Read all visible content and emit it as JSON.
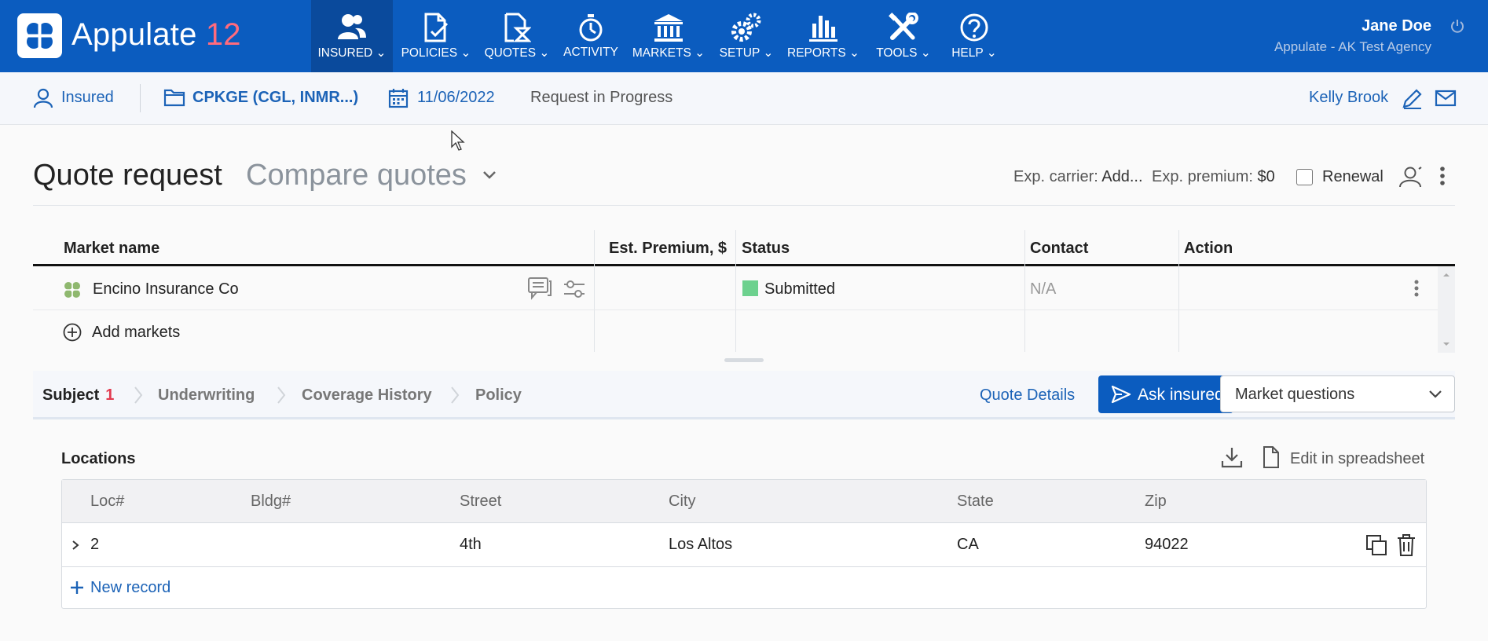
{
  "brand": {
    "name": "Appulate",
    "version": "12"
  },
  "nav": [
    {
      "label": "INSURED",
      "icon": "users-icon",
      "active": true,
      "dropdown": true
    },
    {
      "label": "POLICIES",
      "icon": "policy-document-icon",
      "dropdown": true
    },
    {
      "label": "QUOTES",
      "icon": "quote-hourglass-icon",
      "dropdown": true
    },
    {
      "label": "ACTIVITY",
      "icon": "stopwatch-icon",
      "dropdown": false
    },
    {
      "label": "MARKETS",
      "icon": "bank-icon",
      "dropdown": true
    },
    {
      "label": "SETUP",
      "icon": "gears-icon",
      "dropdown": true
    },
    {
      "label": "REPORTS",
      "icon": "bar-chart-icon",
      "dropdown": true
    },
    {
      "label": "TOOLS",
      "icon": "wrench-screwdriver-icon",
      "dropdown": true
    },
    {
      "label": "HELP",
      "icon": "help-circle-icon",
      "dropdown": true
    }
  ],
  "user": {
    "name": "Jane Doe",
    "agency": "Appulate - AK Test Agency"
  },
  "subbar": {
    "insured": "Insured",
    "policy": "CPKGE (CGL, INMR...)",
    "date": "11/06/2022",
    "status": "Request in Progress",
    "contact": "Kelly Brook"
  },
  "heading": {
    "title": "Quote request",
    "view": "Compare quotes",
    "exp_carrier_label": "Exp. carrier:",
    "exp_carrier_value": "Add...",
    "exp_premium_label": "Exp. premium:",
    "exp_premium_value": "$0",
    "renewal_label": "Renewal",
    "renewal_checked": false
  },
  "markets_table": {
    "columns": [
      "Market name",
      "Est. Premium, $",
      "Status",
      "Contact",
      "Action"
    ],
    "rows": [
      {
        "market": "Encino Insurance Co",
        "premium": "",
        "status": "Submitted",
        "status_color": "#6dd18e",
        "contact": "N/A"
      }
    ],
    "add_label": "Add markets"
  },
  "steps": {
    "items": [
      {
        "label": "Subject",
        "count": "1"
      },
      {
        "label": "Underwriting"
      },
      {
        "label": "Coverage History"
      },
      {
        "label": "Policy"
      }
    ],
    "quote_details": "Quote Details",
    "ask_insured": "Ask insured",
    "market_questions": "Market questions"
  },
  "locations": {
    "title": "Locations",
    "edit_label": "Edit in spreadsheet",
    "columns": [
      "Loc#",
      "Bldg#",
      "Street",
      "City",
      "State",
      "Zip"
    ],
    "rows": [
      {
        "loc": "2",
        "bldg": "",
        "street": "4th",
        "city": "Los Altos",
        "state": "CA",
        "zip": "94022"
      }
    ],
    "new_record": "New record"
  },
  "colors": {
    "primary": "#0b5cbf",
    "link": "#1c63b7",
    "accent": "#e23b4f"
  }
}
